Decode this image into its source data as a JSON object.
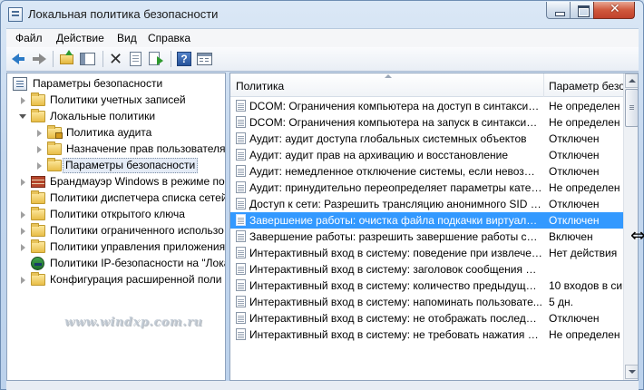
{
  "window": {
    "title": "Локальная политика безопасности"
  },
  "menu": [
    "Файл",
    "Действие",
    "Вид",
    "Справка"
  ],
  "toolbar": {
    "icons": [
      "back-arrow-icon",
      "forward-arrow-icon",
      "up-folder-icon",
      "show-hide-tree-icon",
      "delete-icon",
      "properties-doc-icon",
      "export-list-icon",
      "help-icon",
      "properties-panel-icon"
    ]
  },
  "tree": {
    "root": "Параметры безопасности",
    "items": [
      {
        "label": "Политики учетных записей",
        "expanded": false
      },
      {
        "label": "Локальные политики",
        "expanded": true,
        "children": [
          "Политика аудита",
          "Назначение прав пользователя",
          "Параметры безопасности"
        ]
      },
      {
        "label": "Брандмауэр Windows в режиме пов",
        "expanded": false
      },
      {
        "label": "Политики диспетчера списка сетей"
      },
      {
        "label": "Политики открытого ключа",
        "expanded": false
      },
      {
        "label": "Политики ограниченного использо",
        "expanded": false
      },
      {
        "label": "Политики управления приложения",
        "expanded": false
      },
      {
        "label": "Политики IP-безопасности на \"Лока"
      },
      {
        "label": "Конфигурация расширенной поли",
        "expanded": false
      }
    ]
  },
  "list": {
    "columns": [
      "Политика",
      "Параметр безо"
    ],
    "rows": [
      {
        "policy": "DCOM: Ограничения компьютера на доступ в синтаксис...",
        "value": "Не определен"
      },
      {
        "policy": "DCOM: Ограничения компьютера на запуск в синтаксисе...",
        "value": "Не определен"
      },
      {
        "policy": "Аудит: аудит доступа глобальных системных объектов",
        "value": "Отключен"
      },
      {
        "policy": "Аудит: аудит прав на архивацию и восстановление",
        "value": "Отключен"
      },
      {
        "policy": "Аудит: немедленное отключение системы, если невозмо...",
        "value": "Отключен"
      },
      {
        "policy": "Аудит: принудительно переопределяет параметры катег...",
        "value": "Не определен"
      },
      {
        "policy": "Доступ к сети: Разрешить трансляцию анонимного SID в ...",
        "value": "Отключен"
      },
      {
        "policy": "Завершение работы: очистка файла подкачки виртуальн...",
        "value": "Отключен",
        "selected": true
      },
      {
        "policy": "Завершение работы: разрешить завершение работы сис...",
        "value": "Включен"
      },
      {
        "policy": "Интерактивный вход в систему:  поведение при извлечен...",
        "value": "Нет действия"
      },
      {
        "policy": "Интерактивный вход в систему: заголовок сообщения дл...",
        "value": ""
      },
      {
        "policy": "Интерактивный вход в систему: количество предыдущих ...",
        "value": "10 входов в си"
      },
      {
        "policy": "Интерактивный вход в систему: напоминать пользовате...",
        "value": "5 дн."
      },
      {
        "policy": "Интерактивный вход в систему: не отображать последне...",
        "value": "Отключен"
      },
      {
        "policy": "Интерактивный вход в систему: не требовать нажатия СТ...",
        "value": "Не определен"
      }
    ]
  },
  "watermark": "www.windxp.com.ru",
  "colors": {
    "selection": "#3399ff",
    "folder": "#e8bd47",
    "title_bar": "#c4d7ee"
  }
}
